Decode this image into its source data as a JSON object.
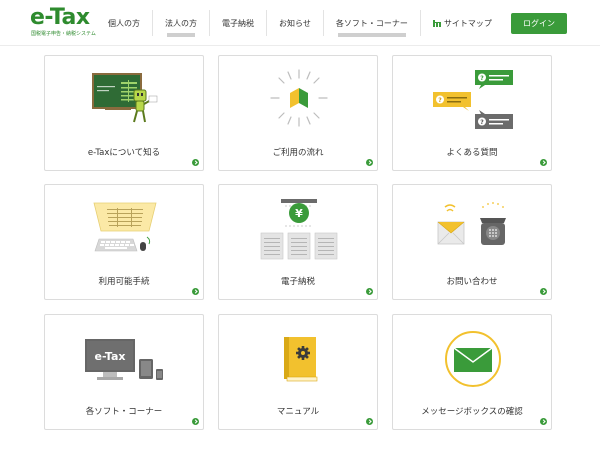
{
  "header": {
    "logo_title": "e-Tax",
    "logo_subtitle": "国税電子申告・納税システム",
    "nav": [
      {
        "label": "個人の方",
        "underlined": false
      },
      {
        "label": "法人の方",
        "underlined": true
      },
      {
        "label": "電子納税",
        "underlined": false
      },
      {
        "label": "お知らせ",
        "underlined": false
      },
      {
        "label": "各ソフト・コーナー",
        "underlined": true
      }
    ],
    "sitemap_label": "サイトマップ",
    "login_label": "ログイン"
  },
  "tiles": [
    {
      "label": "e-Taxについて知る",
      "icon": "blackboard-mascot-icon"
    },
    {
      "label": "ご利用の流れ",
      "icon": "beginner-mark-icon"
    },
    {
      "label": "よくある質問",
      "icon": "faq-speech-bubbles-icon"
    },
    {
      "label": "利用可能手続",
      "icon": "document-keyboard-icon"
    },
    {
      "label": "電子納税",
      "icon": "yen-payment-icon"
    },
    {
      "label": "お問い合わせ",
      "icon": "mail-telephone-icon"
    },
    {
      "label": "各ソフト・コーナー",
      "icon": "etax-devices-icon"
    },
    {
      "label": "マニュアル",
      "icon": "manual-book-icon"
    },
    {
      "label": "メッセージボックスの確認",
      "icon": "envelope-icon"
    }
  ],
  "illustration_text": {
    "faq_mark": "?",
    "yen_mark": "¥",
    "monitor_text": "e-Tax"
  },
  "colors": {
    "brand_green": "#3a9b3a",
    "yellow": "#f2c12e",
    "dark_gray": "#555555"
  }
}
